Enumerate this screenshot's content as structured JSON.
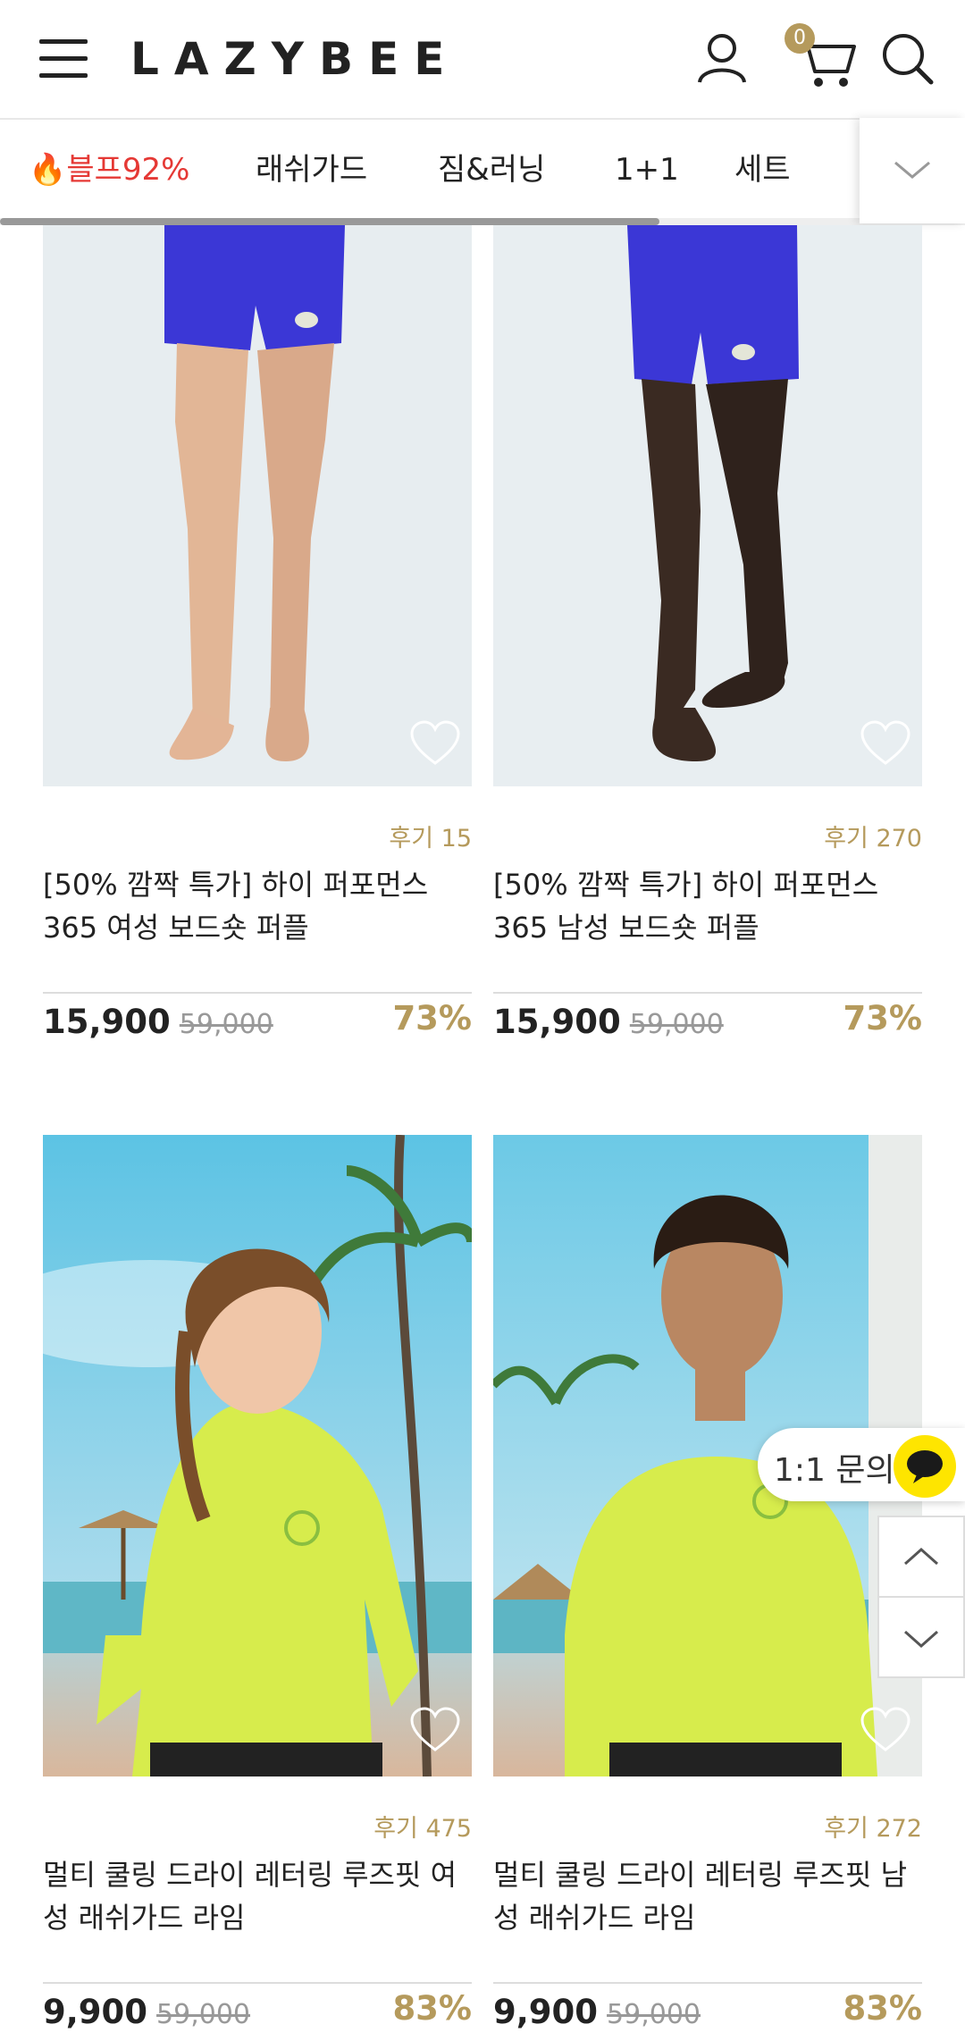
{
  "header": {
    "logo": "LAZYBEE",
    "cart_count": "0"
  },
  "tabs": [
    {
      "label": "🔥블프92%",
      "hot": true
    },
    {
      "label": "래쉬가드"
    },
    {
      "label": "짐&러닝"
    },
    {
      "label": "1+1"
    },
    {
      "label": "세트"
    }
  ],
  "products": [
    {
      "reviews": "후기 15",
      "title": "[50% 깜짝 특가] 하이 퍼포먼스 365 여성 보드숏 퍼플",
      "price": "15,900",
      "original_price": "59,000",
      "discount": "73%"
    },
    {
      "reviews": "후기 270",
      "title": "[50% 깜짝 특가] 하이 퍼포먼스 365 남성 보드숏 퍼플",
      "price": "15,900",
      "original_price": "59,000",
      "discount": "73%"
    },
    {
      "reviews": "후기 475",
      "title": "멀티 쿨링 드라이 레터링 루즈핏 여성 래쉬가드 라임",
      "price": "9,900",
      "original_price": "59,000",
      "discount": "83%"
    },
    {
      "reviews": "후기 272",
      "title": "멀티 쿨링 드라이 레터링 루즈핏 남성 래쉬가드 라임",
      "price": "9,900",
      "original_price": "59,000",
      "discount": "83%"
    }
  ],
  "floating": {
    "inquiry_label": "1:1 문의"
  },
  "colors": {
    "accent_gold": "#b59a5c",
    "hot_red": "#e53935",
    "kakao_yellow": "#fee500"
  }
}
